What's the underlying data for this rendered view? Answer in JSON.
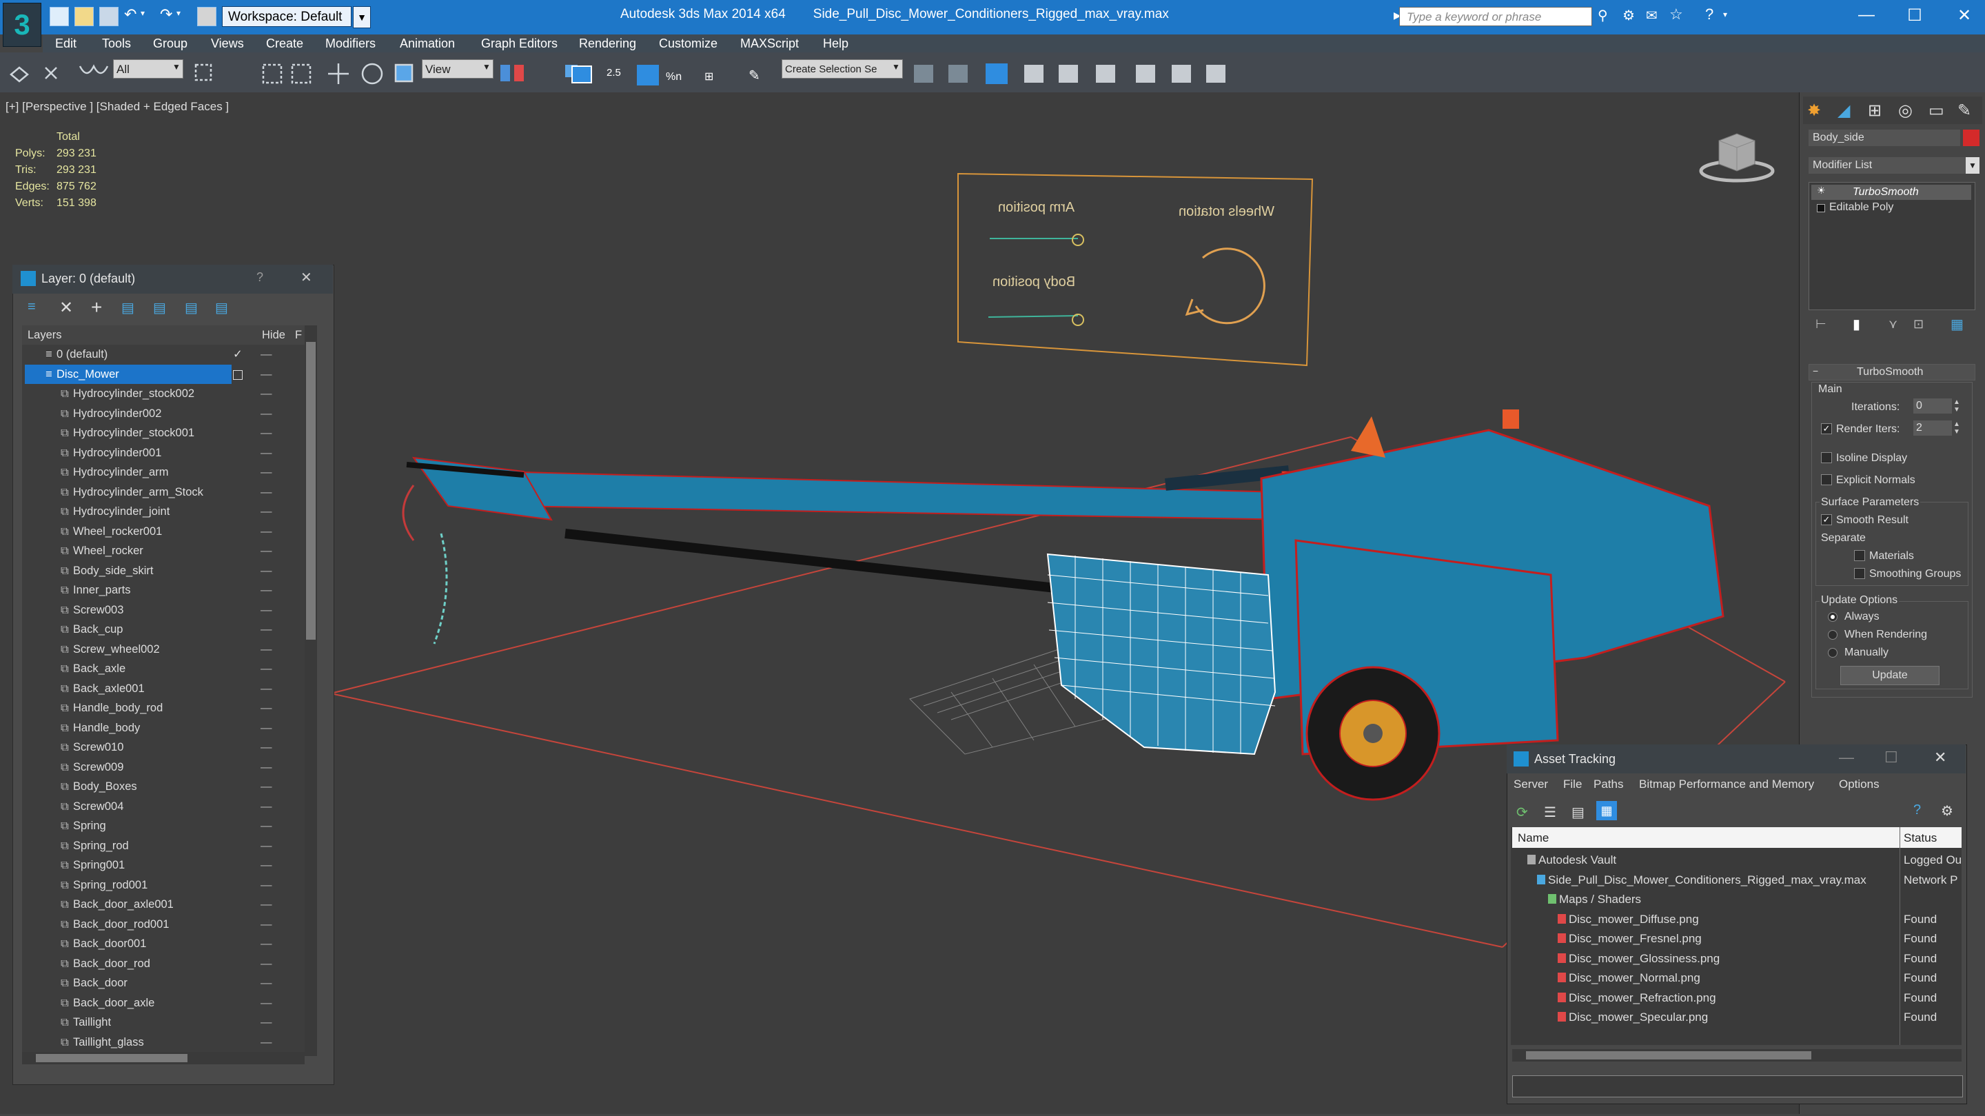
{
  "titlebar": {
    "workspace": "Workspace: Default",
    "app_name": "Autodesk 3ds Max  2014 x64",
    "file_name": "Side_Pull_Disc_Mower_Conditioners_Rigged_max_vray.max",
    "search_placeholder": "Type a keyword or phrase",
    "window_controls": [
      "minimize-icon",
      "maximize-icon",
      "close-icon"
    ]
  },
  "menu": [
    "Edit",
    "Tools",
    "Group",
    "Views",
    "Create",
    "Modifiers",
    "Animation",
    "Graph Editors",
    "Rendering",
    "Customize",
    "MAXScript",
    "Help"
  ],
  "toolbar": {
    "selection_filter": "All",
    "reference_coord": "View",
    "snap_value": "2.5",
    "selection_set": "Create Selection Se"
  },
  "viewport": {
    "label": "[+] [Perspective ] [Shaded + Edged Faces ]",
    "stats_header": "Total",
    "stats": [
      {
        "label": "Polys:",
        "value": "293 231"
      },
      {
        "label": "Tris:",
        "value": "293 231"
      },
      {
        "label": "Edges:",
        "value": "875 762"
      },
      {
        "label": "Verts:",
        "value": "151 398"
      }
    ],
    "rig_labels": {
      "arm": "Arm position",
      "wheels": "Wheels rotation",
      "body": "Body position"
    }
  },
  "layer_panel": {
    "title": "Layer: 0 (default)",
    "help": "?",
    "col_layers": "Layers",
    "col_hide": "Hide",
    "col_freeze": "F",
    "default_layer": "0 (default)",
    "selected_layer": "Disc_Mower",
    "objects": [
      "Hydrocylinder_stock002",
      "Hydrocylinder002",
      "Hydrocylinder_stock001",
      "Hydrocylinder001",
      "Hydrocylinder_arm",
      "Hydrocylinder_arm_Stock",
      "Hydrocylinder_joint",
      "Wheel_rocker001",
      "Wheel_rocker",
      "Body_side_skirt",
      "Inner_parts",
      "Screw003",
      "Back_cup",
      "Screw_wheel002",
      "Back_axle",
      "Back_axle001",
      "Handle_body_rod",
      "Handle_body",
      "Screw010",
      "Screw009",
      "Body_Boxes",
      "Screw004",
      "Spring",
      "Spring_rod",
      "Spring001",
      "Spring_rod001",
      "Back_door_axle001",
      "Back_door_rod001",
      "Back_door001",
      "Back_door_rod",
      "Back_door",
      "Back_door_axle",
      "Taillight",
      "Taillight_glass"
    ]
  },
  "command_panel": {
    "object_name": "Body_side",
    "object_color": "#d42a2a",
    "modifier_list": "Modifier List",
    "stack": [
      "TurboSmooth",
      "Editable Poly"
    ],
    "rollout_title": "TurboSmooth",
    "main": "Main",
    "iterations_label": "Iterations:",
    "iterations_value": "0",
    "render_iters_label": "Render Iters:",
    "render_iters_value": "2",
    "isoline": "Isoline Display",
    "explicit_normals": "Explicit Normals",
    "surface_params": "Surface Parameters",
    "smooth_result": "Smooth Result",
    "separate": "Separate",
    "materials": "Materials",
    "smoothing_groups": "Smoothing Groups",
    "update_options": "Update Options",
    "always": "Always",
    "when_rendering": "When Rendering",
    "manually": "Manually",
    "update_button": "Update"
  },
  "asset_tracking": {
    "title": "Asset Tracking",
    "menu": [
      "Server",
      "File",
      "Paths",
      "Bitmap Performance and Memory",
      "Options"
    ],
    "col_name": "Name",
    "col_status": "Status",
    "rows": [
      {
        "name": "Autodesk Vault",
        "status": "Logged Ou"
      },
      {
        "name": "Side_Pull_Disc_Mower_Conditioners_Rigged_max_vray.max",
        "status": "Network P"
      },
      {
        "name": "Maps / Shaders",
        "status": ""
      },
      {
        "name": "Disc_mower_Diffuse.png",
        "status": "Found"
      },
      {
        "name": "Disc_mower_Fresnel.png",
        "status": "Found"
      },
      {
        "name": "Disc_mower_Glossiness.png",
        "status": "Found"
      },
      {
        "name": "Disc_mower_Normal.png",
        "status": "Found"
      },
      {
        "name": "Disc_mower_Refraction.png",
        "status": "Found"
      },
      {
        "name": "Disc_mower_Specular.png",
        "status": "Found"
      }
    ]
  }
}
